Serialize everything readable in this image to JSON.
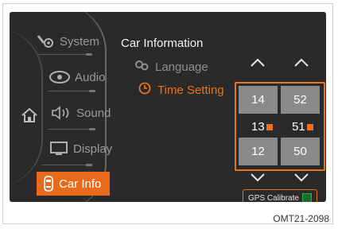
{
  "sidebar": {
    "items": [
      {
        "label": "System",
        "icon": "wrench-gear-icon"
      },
      {
        "label": "Audio",
        "icon": "disc-icon"
      },
      {
        "label": "Sound",
        "icon": "speaker-icon"
      },
      {
        "label": "Display",
        "icon": "monitor-icon"
      },
      {
        "label": "Car Info",
        "icon": "car-icon",
        "active": true
      }
    ],
    "home_icon": "home-icon"
  },
  "main": {
    "title": "Car Information",
    "menu": [
      {
        "label": "Language",
        "icon": "language-icon",
        "state": "dimmed"
      },
      {
        "label": "Time Setting",
        "icon": "clock-icon",
        "state": "selected"
      }
    ]
  },
  "time_picker": {
    "hours_prev": "14",
    "hours_current": "13",
    "hours_next": "12",
    "minutes_prev": "52",
    "minutes_current": "51",
    "minutes_next": "50",
    "hours_unit_marker": "H",
    "minutes_unit_marker": "M"
  },
  "gps": {
    "label": "GPS Calibrate",
    "status_color": "#2fb04a"
  },
  "caption": "OMT21-2098",
  "colors": {
    "accent": "#e8731e",
    "background": "#2a2a2a",
    "text": "#f2f2f2"
  }
}
